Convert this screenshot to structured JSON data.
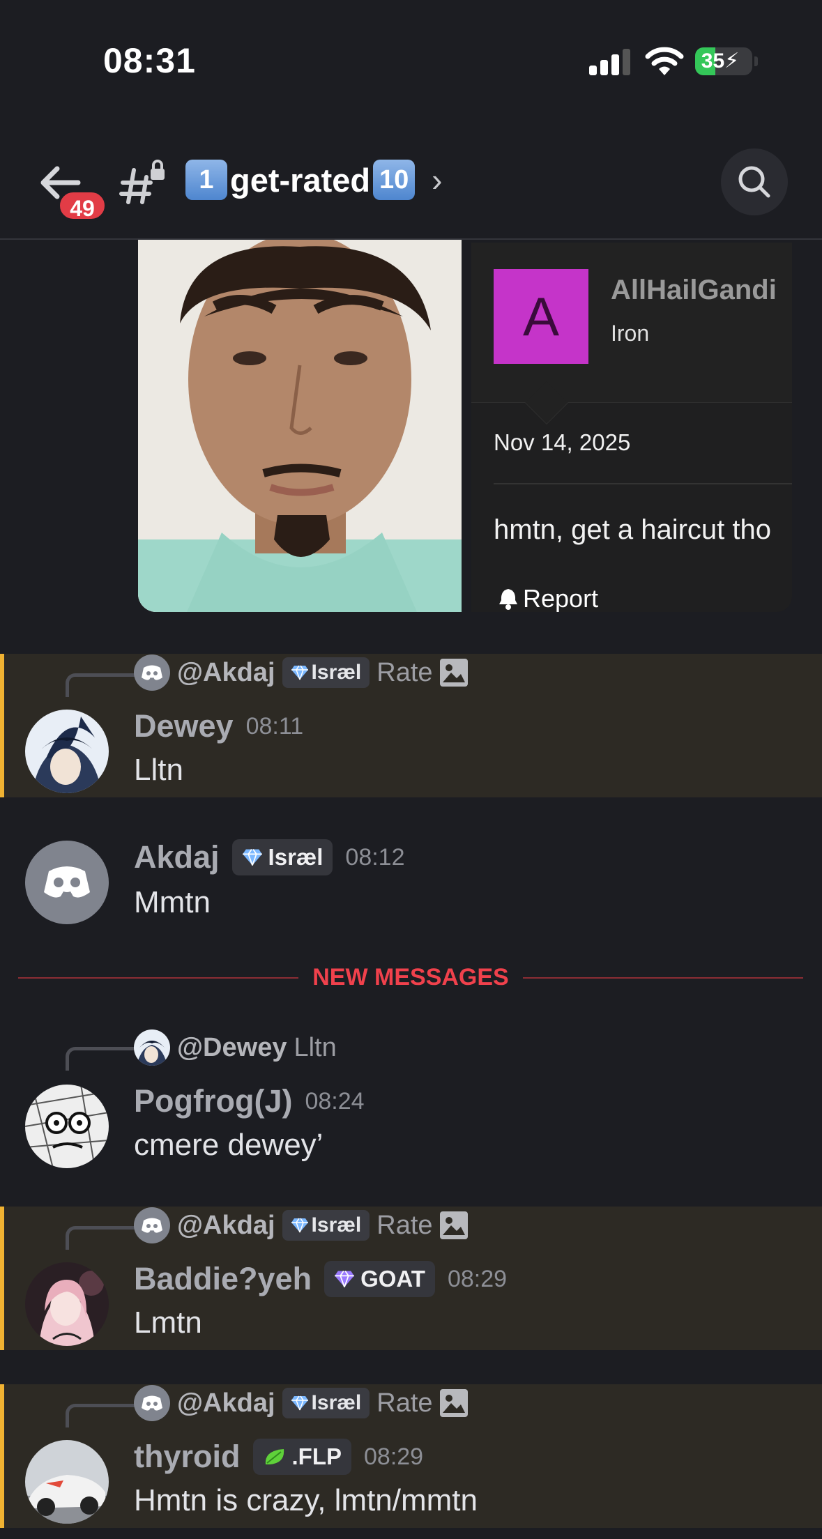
{
  "status_bar": {
    "time": "08:31",
    "battery": "35"
  },
  "header": {
    "unread_count": "49",
    "channel_prefix_emoji": "1",
    "channel_name": "get-rated",
    "channel_suffix_emoji": "10",
    "chevron": "›"
  },
  "embed": {
    "avatar_letter": "A",
    "username": "AllHailGandi",
    "rank": "Iron",
    "date": "Nov 14, 2025",
    "text": "hmtn, get a haircut tho",
    "report_label": "Report"
  },
  "new_messages_label": "NEW MESSAGES",
  "messages": [
    {
      "reply": {
        "name": "@Akdaj",
        "tag": "Isræl",
        "text": "Rate"
      },
      "username": "Dewey",
      "time": "08:11",
      "text": "Lltn"
    },
    {
      "username": "Akdaj",
      "tag": "Isræl",
      "time": "08:12",
      "text": "Mmtn"
    },
    {
      "reply": {
        "name": "@Dewey",
        "text": "Lltn"
      },
      "username": "Pogfrog(J)",
      "time": "08:24",
      "text": "cmere dewey’"
    },
    {
      "reply": {
        "name": "@Akdaj",
        "tag": "Isræl",
        "text": "Rate"
      },
      "username": "Baddie?yeh",
      "tag": "GOAT",
      "time": "08:29",
      "text": "Lmtn"
    },
    {
      "reply": {
        "name": "@Akdaj",
        "tag": "Isræl",
        "text": "Rate"
      },
      "username": "thyroid",
      "tag": ".FLP",
      "time": "08:29",
      "text": "Hmtn is crazy, lmtn/mmtn"
    }
  ],
  "colors": {
    "background": "#1c1d22",
    "highlight_bar": "#f0b232",
    "new_messages": "#f0414c",
    "unread_badge": "#e23c46",
    "embed_avatar": "#c534c9"
  }
}
